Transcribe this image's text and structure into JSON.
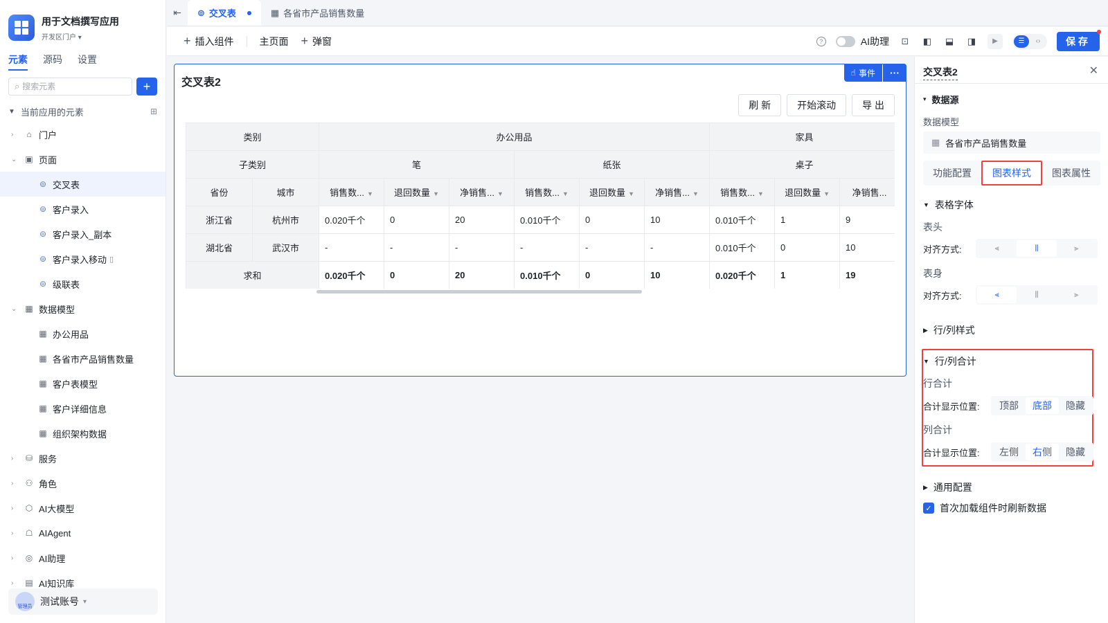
{
  "app": {
    "name": "用于文档撰写应用",
    "portal": "开发区门户"
  },
  "sidebar": {
    "tabs": [
      "元素",
      "源码",
      "设置"
    ],
    "search_placeholder": "搜索元素",
    "section_title": "当前应用的元素",
    "tree": [
      {
        "label": "门户",
        "level": 0,
        "arrow": "›",
        "icon": "home-icon"
      },
      {
        "label": "页面",
        "level": 0,
        "arrow": "⌄",
        "icon": "page-icon"
      },
      {
        "label": "交叉表",
        "level": 1,
        "icon": "page-link-icon",
        "active": true
      },
      {
        "label": "客户录入",
        "level": 1,
        "icon": "page-link-icon"
      },
      {
        "label": "客户录入_副本",
        "level": 1,
        "icon": "page-link-icon"
      },
      {
        "label": "客户录入移动",
        "level": 1,
        "icon": "page-link-icon",
        "mobile": true
      },
      {
        "label": "级联表",
        "level": 1,
        "icon": "page-link-icon"
      },
      {
        "label": "数据模型",
        "level": 0,
        "arrow": "⌄",
        "icon": "table-icon"
      },
      {
        "label": "办公用品",
        "level": 1,
        "icon": "table-icon"
      },
      {
        "label": "各省市产品销售数量",
        "level": 1,
        "icon": "table-icon"
      },
      {
        "label": "客户表模型",
        "level": 1,
        "icon": "table-icon"
      },
      {
        "label": "客户详细信息",
        "level": 1,
        "icon": "table-icon"
      },
      {
        "label": "组织架构数据",
        "level": 1,
        "icon": "table-icon"
      },
      {
        "label": "服务",
        "level": 0,
        "arrow": "›",
        "icon": "service-icon"
      },
      {
        "label": "角色",
        "level": 0,
        "arrow": "›",
        "icon": "role-icon"
      },
      {
        "label": "AI大模型",
        "level": 0,
        "arrow": "›",
        "icon": "ai-model-icon"
      },
      {
        "label": "AIAgent",
        "level": 0,
        "arrow": "›",
        "icon": "robot-icon"
      },
      {
        "label": "AI助理",
        "level": 0,
        "arrow": "›",
        "icon": "ai-assistant-icon"
      },
      {
        "label": "AI知识库",
        "level": 0,
        "arrow": "›",
        "icon": "book-icon"
      }
    ],
    "user": {
      "name": "测试账号",
      "role": "管理员"
    }
  },
  "tabs": [
    {
      "label": "交叉表",
      "active": true,
      "modified": true
    },
    {
      "label": "各省市产品销售数量",
      "active": false
    }
  ],
  "toolbar": {
    "insert": "插入组件",
    "home": "主页面",
    "popup": "弹窗",
    "ai_label": "AI助理",
    "save": "保存"
  },
  "widget": {
    "title": "交叉表2",
    "event": "事件",
    "buttons": [
      "刷 新",
      "开始滚动",
      "导 出"
    ],
    "header_rows": {
      "category_label": "类别",
      "subcategory_label": "子类别",
      "province_label": "省份",
      "city_label": "城市",
      "categories": [
        "办公用品",
        "家具"
      ],
      "subcategories": [
        "笔",
        "纸张",
        "桌子"
      ],
      "measures": [
        "销售数...",
        "退回数量",
        "净销售...",
        "销售数...",
        "退回数量",
        "净销售...",
        "销售数...",
        "退回数量",
        "净销售..."
      ]
    },
    "rows": [
      {
        "province": "浙江省",
        "city": "杭州市",
        "values": [
          "0.020千个",
          "0",
          "20",
          "0.010千个",
          "0",
          "10",
          "0.010千个",
          "1",
          "9"
        ]
      },
      {
        "province": "湖北省",
        "city": "武汉市",
        "values": [
          "-",
          "-",
          "-",
          "-",
          "-",
          "-",
          "0.010千个",
          "0",
          "10"
        ]
      }
    ],
    "total": {
      "label": "求和",
      "values": [
        "0.020千个",
        "0",
        "20",
        "0.010千个",
        "0",
        "10",
        "0.020千个",
        "1",
        "19"
      ]
    }
  },
  "panel": {
    "title": "交叉表2",
    "datasource": "数据源",
    "model_label": "数据模型",
    "model_value": "各省市产品销售数量",
    "tabs": [
      "功能配置",
      "图表样式",
      "图表属性"
    ],
    "font_section": "表格字体",
    "header_label": "表头",
    "body_label": "表身",
    "align_label": "对齐方式:",
    "row_col_style": "行/列样式",
    "row_col_total": "行/列合计",
    "row_total": "行合计",
    "col_total": "列合计",
    "pos_label": "合计显示位置:",
    "row_pos_options": [
      "顶部",
      "底部",
      "隐藏"
    ],
    "col_pos_options": [
      "左侧",
      "右侧",
      "隐藏"
    ],
    "general": "通用配置",
    "refresh_on_load": "首次加载组件时刷新数据"
  },
  "colors": {
    "accent": "#2563eb",
    "highlight": "#f53f3f"
  }
}
